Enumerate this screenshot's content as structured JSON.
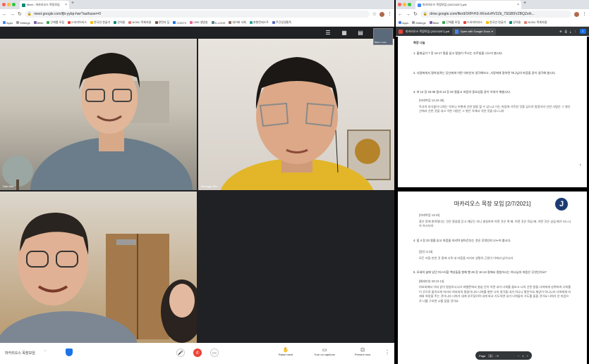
{
  "left_window": {
    "tab_title": "Meet - 마카리오스 목장모임",
    "url": "meet.google.com/fjb-yybp-hwr?authuser=0",
    "bookmarks": [
      "Apps",
      "Settings",
      "Bible",
      "단체를 모집",
      "드리미어리스",
      "한국인 한글기",
      "강의들",
      "NCBC 목회자들",
      "관련자 딥",
      "CGNTV",
      "CBS 생방송",
      "K-LOVE",
      "네이버 사회",
      "춘향컨테스트",
      "주간성경통독"
    ],
    "participants": [
      {
        "name": "Dan Kim"
      },
      {
        "name": "Seongjin Kim"
      },
      {
        "name": ""
      }
    ],
    "meeting_name": "마카리오스 목장모임",
    "controls": {
      "raise": "Raise hand",
      "captions": "Turn on captions",
      "present": "Present now"
    },
    "top_label": "Blake a note"
  },
  "right_window": {
    "tab_title": "마카리오스 목장모임 (20210207).pdf",
    "url": "drive.google.com/file/d/1RPrH3-XKnxIvHV2Zb_7SGB5VZBQZeih...",
    "bookmarks": [
      "Apps",
      "Settings",
      "Bible",
      "단체를 모집",
      "드리미어리스",
      "한국인 한글기",
      "강의들",
      "NCBC 목회자들"
    ],
    "file_name": "마카리오스 목장모임 (20210207).pdf",
    "open_with": "Open with Google Docs",
    "page1": {
      "heading": "목장 나눔",
      "q1": "1. 출애굽기 7 장 14-17 절을 읽고 말씀이 주시는 가르침을 나누어 봅시다.",
      "q2": "2. 사람에게서 잘하실려는 당신에게 어떤 의미인지 생각해보고, 사랑에게 잘하면 하나님의 마음을 같이 생각해 봅시다.",
      "q3": "3. 마 12 장 34-35 절과 13 장 23 절을고 마음의 중요성을 같이 이야기 해봅시다.",
      "ref": "[마태복음 12:34-35]",
      "ref_text": "독사의 자식들아 너희는 악하니 어떻게 선한 말을 할 수 있느냐 이는 마음에 가득한 것을 입으로 말함이라 선한 사람은 그 쌓은 선에서 선한 것을 내고 악한 사람은 그 쌓은 악에서 악한 것을 내느니라"
    },
    "page2": {
      "title": "마카리오스 목장 모임 [2/7/2021]",
      "ref1": "[마태복음 13:23]",
      "ref1_text": "좋은 땅에 뿌려졌다는 것은 말씀을 듣고 깨닫는 자니 결실하여 어떤 것은 백 배, 어떤 것은 육십 배, 어떤 것은 삼십 배가 되느니라 하시더라",
      "q4": "4. 잠 4 장 23 절을 읽고 마음을 지키며 살아간다는 것은 무엇인지 나누어 봅시다.",
      "ref2": "[잠언 4:23]",
      "ref2_text": "모든 지킬 만한 것 중에 더욱 네 마음을 지키라 생명의 근원이 이에서 남이니라",
      "q5": "5. 모세의 삶에 있던 마스터할 백성들을 향해 행 28 장 10-13 절에서 말씀하시는 하나님의 마음은 무엇인가요?",
      "ref3": "[예레미야 29:10-13]",
      "ref3_text": "여호와께서 이와 같이 말씀하시니라 바벨론에서 칠십 년이 차면 내가 너희를 돌보고 나의 선한 말을 너희에게 성취하여 너희를 이 곳으로 돌아오게 하리라 여호와의 말씀이니라 너희를 향한 나의 생각을 내가 아나니 평안이요 재앙이 아니니라 너희에게 미래와 희망을 주는 것이니라 너희가 내게 부르짖으며 내게 와서 기도하면 내가 너희들의 기도를 들을 것이요 너희가 온 마음으로 너를 구하면 나를 찾을 것이요"
    },
    "page_ctrl": {
      "label": "Page",
      "current": "1",
      "total": "/ 2"
    }
  },
  "colors": {
    "accent": "#1a73e8",
    "meet_bg": "#202124"
  }
}
